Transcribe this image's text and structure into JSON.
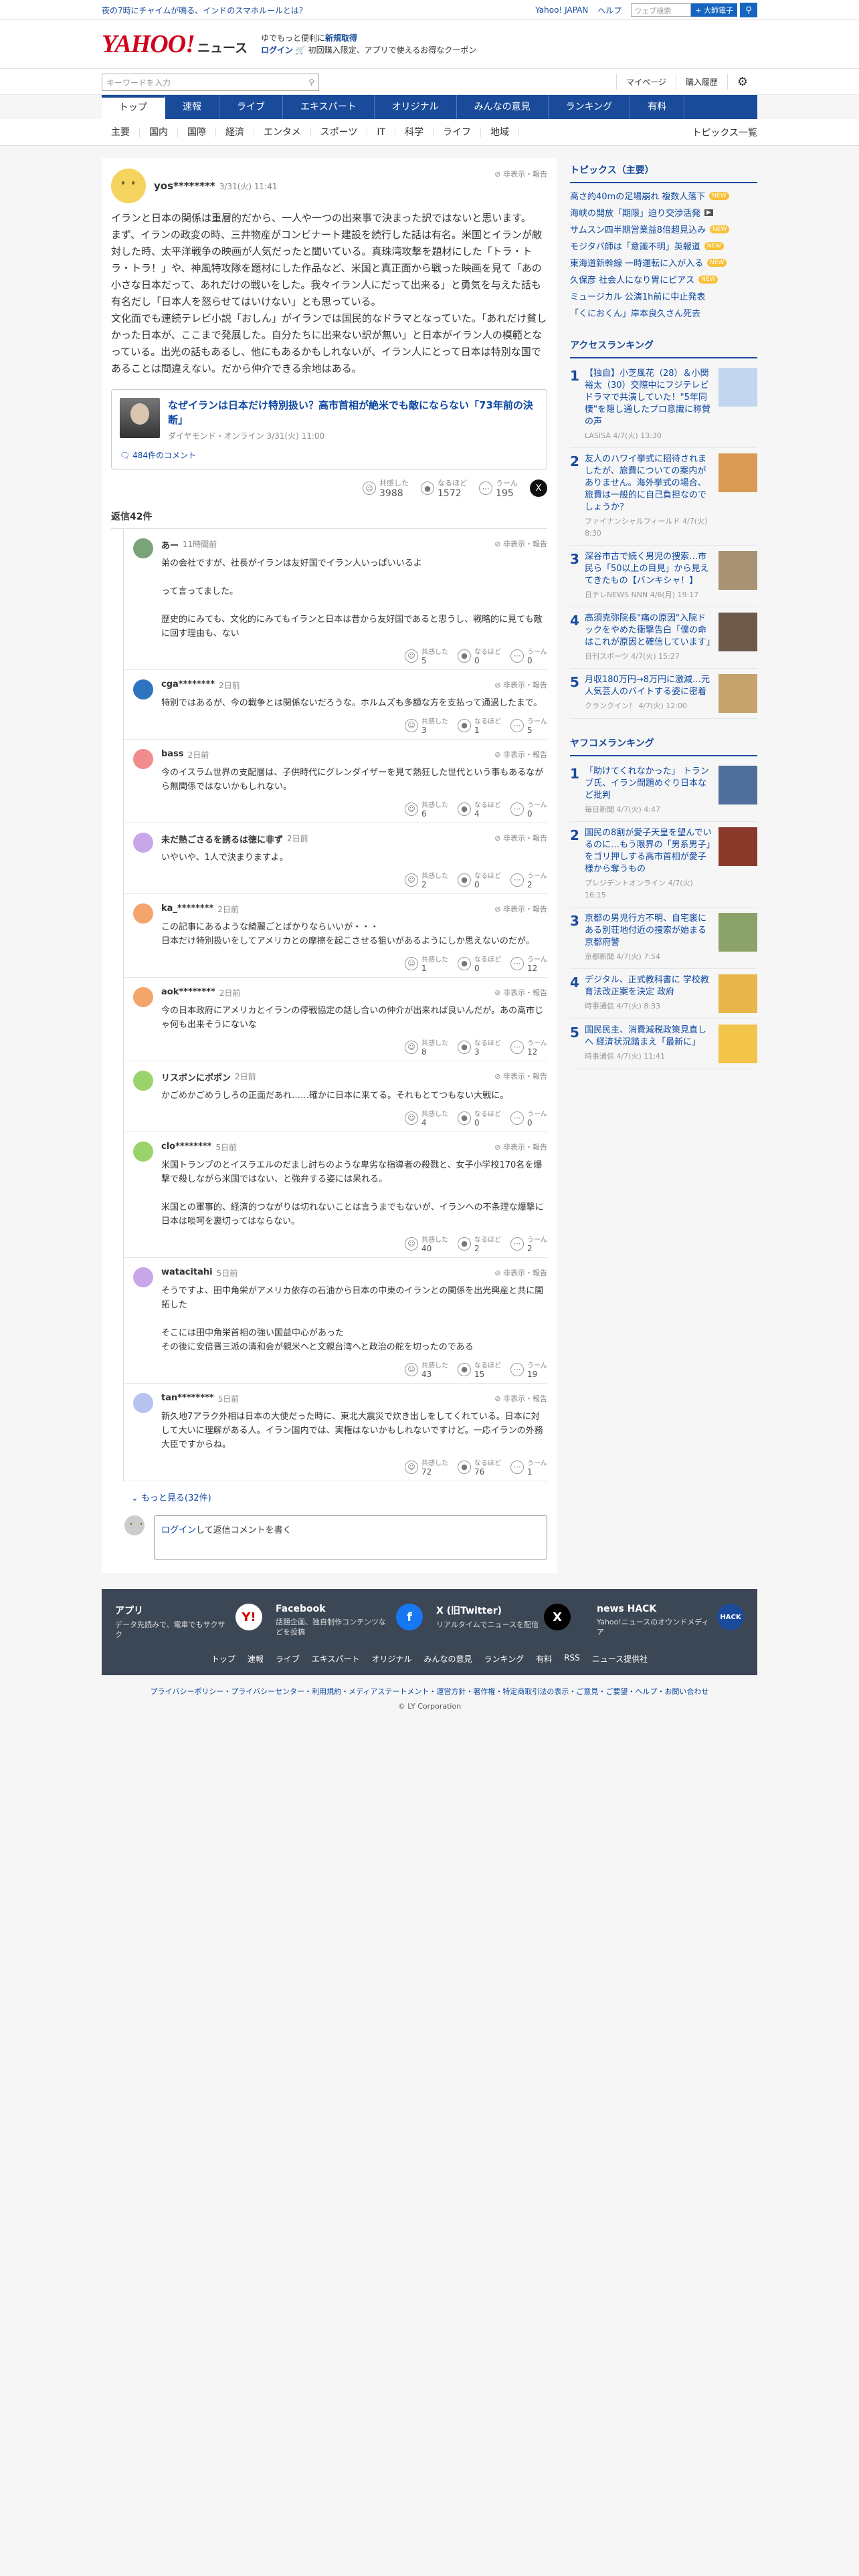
{
  "topbar": {
    "promo": "夜の7時にチャイムが鳴る、インドのスマホルールとは？",
    "links": [
      "Yahoo! JAPAN",
      "ヘルプ"
    ],
    "search_placeholder": "ウェブ検索",
    "search_button": "+ 大師電子",
    "search_icon": "search-icon"
  },
  "masthead": {
    "logo": "YAHOO!",
    "logo_sub": "JAPAN",
    "section": "ニュース",
    "msg1": "ゆでもっと便利に",
    "msg1_link": "新規取得",
    "msg2_link": "ログイン",
    "msg2": "初回購入限定、アプリで使えるお得なクーポン"
  },
  "util": {
    "keyword_placeholder": "キーワードを入力",
    "mypage": "マイページ",
    "history": "購入履歴",
    "settings_icon": "gear-icon"
  },
  "gnav": [
    "トップ",
    "速報",
    "ライブ",
    "エキスパート",
    "オリジナル",
    "みんなの意見",
    "ランキング",
    "有料"
  ],
  "snav": {
    "items": [
      "主要",
      "国内",
      "国際",
      "経済",
      "エンタメ",
      "スポーツ",
      "IT",
      "科学",
      "ライフ",
      "地域"
    ],
    "all": "トピックス一覧"
  },
  "comment": {
    "user": "yos********",
    "date": "3/31(火) 11:41",
    "hide": "非表示・報告",
    "text": "イランと日本の関係は重層的だから、一人や一つの出来事で決まった訳ではないと思います。\nまず、イランの政変の時、三井物産がコンビナート建設を続行した話は有名。米国とイランが敵対した時、太平洋戦争の映画が人気だったと聞いている。真珠湾攻撃を題材にした「トラ・トラ・トラ！」や、神風特攻隊を題材にした作品など、米国と真正面から戦った映画を見て「あの小さな日本だって、あれだけの戦いをした。我々イラン人にだって出来る」と勇気を与えた話も有名だし「日本人を怒らせてはいけない」とも思っている。\n文化面でも連続テレビ小説「おしん」がイランでは国民的なドラマとなっていた。「あれだけ貧しかった日本が、ここまで発展した。自分たちに出来ない訳が無い」と日本がイラン人の模範となっている。出光の話もあるし、他にもあるかもしれないが、イラン人にとって日本は特別な国であることは間違えない。だから仲介できる余地はある。",
    "article": {
      "title": "なぜイランは日本だけ特別扱い？高市首相が絶米でも敵にならない「73年前の決断」",
      "source": "ダイヤモンド・オンライン 3/31(火) 11:00",
      "comments": "484件のコメント"
    },
    "reactions": [
      {
        "label": "共感した",
        "count": "3988",
        "icon": "smile-icon"
      },
      {
        "label": "なるほど",
        "count": "1572",
        "icon": "bulb-icon"
      },
      {
        "label": "うーん",
        "count": "195",
        "icon": "hmm-icon"
      }
    ],
    "x_icon": "x-share-icon"
  },
  "replies_count_label": "返信42件",
  "replies": [
    {
      "user": "あー",
      "date": "11時間前",
      "color": "#7aa37a",
      "text": "弟の会社ですが、社長がイランは友好国でイラン人いっぱいいるよ\n\nって言ってました。\n\n歴史的にみても、文化的にみてもイランと日本は昔から友好国であると思うし、戦略的に見ても敵に回す理由も、ない",
      "r": [
        "5",
        "0",
        "0"
      ]
    },
    {
      "user": "cga********",
      "date": "2日前",
      "color": "#2f74c0",
      "text": "特別ではあるが、今の戦争とは関係ないだろうな。ホルムズも多額な方を支払って通過したまで。",
      "r": [
        "3",
        "1",
        "5"
      ]
    },
    {
      "user": "bass",
      "date": "2日前",
      "color": "#f08c8c",
      "text": "今のイスラム世界の支配層は、子供時代にグレンダイザーを見て熱狂した世代という事もあるながら無関係ではないかもしれない。",
      "r": [
        "6",
        "4",
        "0"
      ]
    },
    {
      "user": "未だ熱ごさるを誘るは徳に非ず",
      "date": "2日前",
      "color": "#c9a6e8",
      "text": "いやいや、1人で決まりますよ。",
      "r": [
        "2",
        "0",
        "2"
      ]
    },
    {
      "user": "ka_********",
      "date": "2日前",
      "color": "#f3a56b",
      "text": "この記事にあるような綺麗ごとばかりならいいが・・・\n日本だけ特別扱いをしてアメリカとの摩擦を起こさせる狙いがあるようにしか思えないのだが。",
      "r": [
        "1",
        "0",
        "12"
      ]
    },
    {
      "user": "aok********",
      "date": "2日前",
      "color": "#f3a56b",
      "text": "今の日本政府にアメリカとイランの停戦協定の話し合いの仲介が出来れば良いんだが。あの高市じゃ何も出来そうにないな",
      "r": [
        "8",
        "3",
        "12"
      ]
    },
    {
      "user": "リスボンにポポン",
      "date": "2日前",
      "color": "#9bd36b",
      "text": "かごめかごめうしろの正面だあれ……確かに日本に来てる。それもとてつもない大戦に。",
      "r": [
        "4",
        "0",
        "0"
      ]
    },
    {
      "user": "clo********",
      "date": "5日前",
      "color": "#9bd36b",
      "text": "米国トランプのとイスラエルのだまし討ちのような卑劣な指導者の殺戮と、女子小学校170名を爆撃で殺しながら米国ではない、と強弁する姿には呆れる。\n\n米国との軍事的、経済的つながりは切れないことは言うまでもないが、イランへの不条理な爆撃に日本は啖呵を裏切ってはならない。",
      "r": [
        "40",
        "2",
        "2"
      ]
    },
    {
      "user": "watacitahi",
      "date": "5日前",
      "color": "#c9a6e8",
      "text": "そうですよ、田中角栄がアメリカ依存の石油から日本の中東のイランとの関係を出光興産と共に開拓した\n\nそこには田中角栄首相の強い国益中心があった\nその後に安倍晋三派の清和会が親米へと文親台湾へと政治の舵を切ったのである",
      "r": [
        "43",
        "15",
        "19"
      ]
    },
    {
      "user": "tan********",
      "date": "5日前",
      "color": "#b7c3ee",
      "text": "新久地7アラク外相は日本の大使だった時に、東北大震災で炊き出しをしてくれている。日本に対して大いに理解がある人。イラン国内では、実権はないかもしれないですけど。一応イランの外務大臣ですからね。",
      "r": [
        "72",
        "76",
        "1"
      ]
    }
  ],
  "reply_reactions": [
    "共感した",
    "なるほど",
    "うーん"
  ],
  "more_label": "もっと見る(32件)",
  "reply_box": {
    "login": "ログイン",
    "text": "して返信コメントを書く"
  },
  "side": {
    "topics_title": "トピックス（主要）",
    "topics": [
      {
        "t": "高さ約40mの足場崩れ 複数人落下",
        "badge": "new"
      },
      {
        "t": "海峡の開放「期限」迫り交渉活発",
        "badge": "cam"
      },
      {
        "t": "サムスン四半期営業益8倍超見込み",
        "badge": "new"
      },
      {
        "t": "モジタバ師は「意識不明」英報道",
        "badge": "new"
      },
      {
        "t": "東海道新幹線 一時運転に入が入る",
        "badge": "new"
      },
      {
        "t": "久保彦 社会人になり胃にピアス",
        "badge": "new"
      },
      {
        "t": "ミュージカル 公演1h前に中止発表",
        "badge": ""
      },
      {
        "t": "「くにおくん」岸本良久さん死去",
        "badge": ""
      }
    ],
    "access_title": "アクセスランキング",
    "access": [
      {
        "no": "1",
        "t": "【独自】小芝風花（28）＆小関裕太（30）交際中にフジテレビドラマで共演していた！\"5年同棲\"を隠し通したプロ意識に称賛の声",
        "s": "LASISA 4/7(火) 13:30",
        "c": "#c2d6f0"
      },
      {
        "no": "2",
        "t": "友人のハワイ挙式に招待されましたが、旅費についての案内がありません。海外挙式の場合、旅費は一般的に自己負担なのでしょうか？",
        "s": "ファイナンシャルフィールド 4/7(火) 8:30",
        "c": "#d99a55"
      },
      {
        "no": "3",
        "t": "深谷市古で続く男児の捜索…市民ら「50以上の目見」から見えてきたもの【バンキシャ！】",
        "s": "日テレNEWS NNN 4/6(月) 19:17",
        "c": "#a89274"
      },
      {
        "no": "4",
        "t": "高須克弥院長\"痛の原因\"入院ドックをやめた衝撃告白「僕の命はこれが原因と確信しています」",
        "s": "日刊スポーツ 4/7(火) 15:27",
        "c": "#6d5a4a"
      },
      {
        "no": "5",
        "t": "月収180万円→8万円に激減…元人気芸人のバイトする姿に密着",
        "s": "クランクイン！ 4/7(火) 12:00",
        "c": "#c6a36c"
      }
    ],
    "comment_title": "ヤフコメランキング",
    "comment_rank": [
      {
        "no": "1",
        "t": "「助けてくれなかった」 トランプ氏、イラン問題めぐり日本など批判",
        "s": "毎日新聞 4/7(火) 4:47",
        "c": "#4f6e9a"
      },
      {
        "no": "2",
        "t": "国民の8割が愛子天皇を望んでいるのに…もう限界の「男系男子」をゴリ押しする高市首相が愛子様から奪うもの",
        "s": "プレジデントオンライン 4/7(火) 16:15",
        "c": "#8a3a2a"
      },
      {
        "no": "3",
        "t": "京都の男児行方不明、自宅裏にある別荘地付近の捜索が始まる 京都府警",
        "s": "京都新聞 4/7(火) 7:54",
        "c": "#8ba36a"
      },
      {
        "no": "4",
        "t": "デジタル、正式教科書に 学校教育法改正案を決定 政府",
        "s": "時事通信 4/7(火) 8:33",
        "c": "#e8b64a"
      },
      {
        "no": "5",
        "t": "国民民主、消費減税政策見直しへ 経済状況踏まえ「最新に」",
        "s": "時事通信 4/7(火) 11:41",
        "c": "#f2c44a"
      }
    ]
  },
  "footer": {
    "apps": [
      {
        "title": "アプリ",
        "desc": "データ先読みで、電車でもサクサク",
        "icon": "yahoo-app-icon",
        "mark": "Y!",
        "bg": "#ffffff",
        "fg": "#c00"
      },
      {
        "title": "Facebook",
        "desc": "話題企画、独自制作コンテンツなどを投稿",
        "icon": "facebook-icon",
        "mark": "f",
        "bg": "#1877f2",
        "fg": "#fff"
      },
      {
        "title": "X (旧Twitter)",
        "desc": "リアルタイムでニュースを配信",
        "icon": "x-icon",
        "mark": "X",
        "bg": "#000000",
        "fg": "#fff"
      },
      {
        "title": "news HACK",
        "desc": "Yahoo!ニュースのオウンドメディア",
        "icon": "news-hack-icon",
        "mark": "HACK",
        "bg": "#1a4b9b",
        "fg": "#fff"
      }
    ],
    "links": [
      "トップ",
      "速報",
      "ライブ",
      "エキスパート",
      "オリジナル",
      "みんなの意見",
      "ランキング",
      "有料",
      "RSS",
      "ニュース提供社"
    ],
    "legal": "プライバシーポリシー・プライバシーセンター・利用規約・メディアステートメント・運営方針・著作権・特定商取引法の表示・ご意見・ご要望・ヘルプ・お問い合わせ",
    "copyright": "© LY Corporation"
  }
}
